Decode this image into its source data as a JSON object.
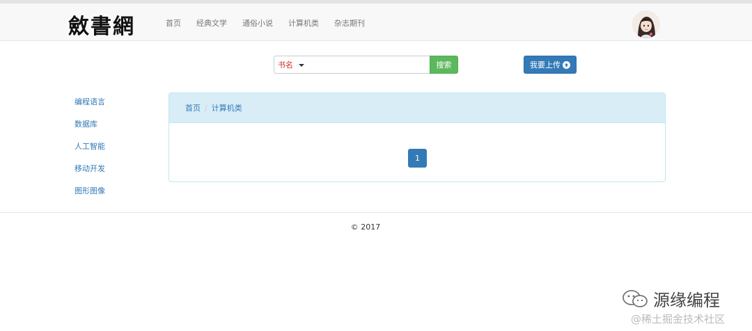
{
  "header": {
    "logo_text": "斂書網",
    "nav": [
      "首页",
      "经典文学",
      "通俗小说",
      "计算机类",
      "杂志期刊"
    ]
  },
  "search": {
    "category": "书名",
    "placeholder": "",
    "button_label": "搜索"
  },
  "upload": {
    "label": "我要上传"
  },
  "sidebar": {
    "items": [
      "编程语言",
      "数据库",
      "人工智能",
      "移动开发",
      "图形图像"
    ]
  },
  "breadcrumb": {
    "home": "首页",
    "separator": "/",
    "current": "计算机类"
  },
  "pagination": {
    "current_page": "1"
  },
  "footer": {
    "copyright": "© 2017"
  },
  "watermark": {
    "title": "源缘编程",
    "sub": "@稀土掘金技术社区"
  },
  "colors": {
    "primary": "#337ab7",
    "success": "#5cb85c",
    "panel_heading": "#d9edf7",
    "select_text": "#c9302c"
  }
}
